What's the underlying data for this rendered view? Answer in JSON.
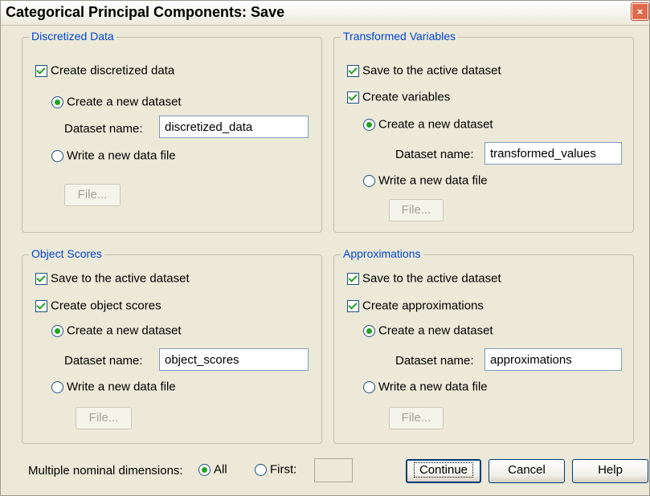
{
  "dialog": {
    "title": "Categorical Principal Components: Save",
    "close_symbol": "×"
  },
  "discretized": {
    "title": "Discretized Data",
    "create_label": "Create discretized data",
    "new_dataset_label": "Create a new dataset",
    "dataset_name_label": "Dataset name:",
    "dataset_name_value": "discretized_data",
    "write_file_label": "Write a new data file",
    "file_button": "File..."
  },
  "transformed": {
    "title": "Transformed Variables",
    "save_active_label": "Save to the active dataset",
    "create_label": "Create variables",
    "new_dataset_label": "Create a new dataset",
    "dataset_name_label": "Dataset name:",
    "dataset_name_value": "transformed_values",
    "write_file_label": "Write a new data file",
    "file_button": "File..."
  },
  "object_scores": {
    "title": "Object Scores",
    "save_active_label": "Save to the active dataset",
    "create_label": "Create object scores",
    "new_dataset_label": "Create a new dataset",
    "dataset_name_label": "Dataset name:",
    "dataset_name_value": "object_scores",
    "write_file_label": "Write a new data file",
    "file_button": "File..."
  },
  "approximations": {
    "title": "Approximations",
    "save_active_label": "Save to the active dataset",
    "create_label": "Create approximations",
    "new_dataset_label": "Create a new dataset",
    "dataset_name_label": "Dataset name:",
    "dataset_name_value": "approximations",
    "write_file_label": "Write a new data file",
    "file_button": "File..."
  },
  "footer": {
    "multiple_nominal_label": "Multiple nominal dimensions:",
    "all_label": "All",
    "first_label": "First:",
    "first_value": ""
  },
  "buttons": {
    "continue": "Continue",
    "cancel": "Cancel",
    "help": "Help"
  }
}
